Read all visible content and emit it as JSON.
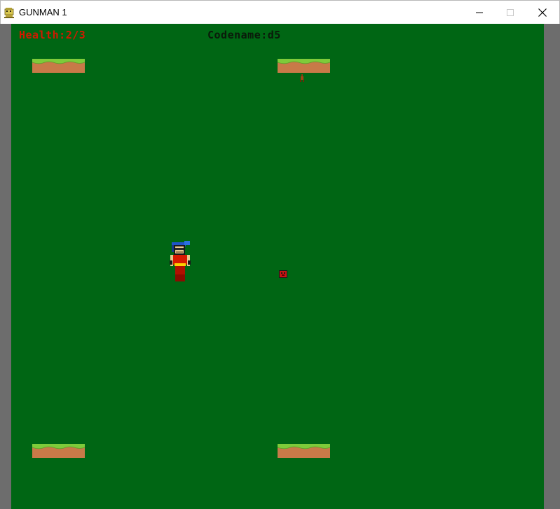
{
  "window": {
    "title": "GUNMAN 1",
    "icon": "python-icon"
  },
  "controls": {
    "minimize_icon": "minimize-icon",
    "maximize_icon": "maximize-icon",
    "close_icon": "close-icon"
  },
  "hud": {
    "health_text": "Health:2/3",
    "codename_text": "Codename:d5"
  },
  "colors": {
    "game_background": "#006614",
    "health_text": "#d11a00",
    "codename_text": "#0a1a0a",
    "platform_dirt": "#c87a48",
    "platform_grass": "#7ecb3a",
    "player_body": "#d81a00",
    "player_hair": "#1f54c8",
    "enemy_body": "#c81414"
  },
  "scene": {
    "platforms": [
      "platform-top-left",
      "platform-top-right",
      "platform-bottom-left",
      "platform-bottom-right"
    ],
    "player": "player-gunman",
    "enemy": "enemy-drone",
    "bullet": "small-projectile"
  }
}
